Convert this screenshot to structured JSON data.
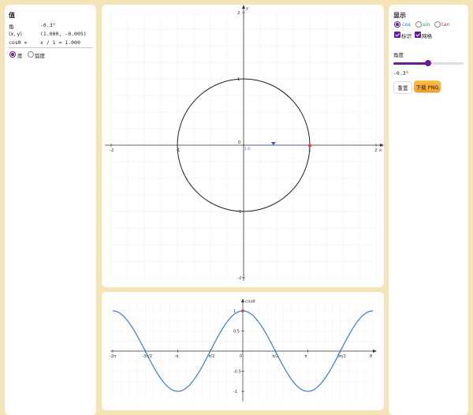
{
  "values_panel": {
    "title": "值",
    "rows": [
      {
        "label": "角",
        "value": "-0.3°"
      },
      {
        "label": "(x, y)",
        "value": "(1.000, -0.005)"
      },
      {
        "label": "cosθ =",
        "value": "x / 1 = 1.000"
      }
    ],
    "unit_options": [
      {
        "label": "度",
        "selected": true
      },
      {
        "label": "弧度",
        "selected": false
      }
    ]
  },
  "display_panel": {
    "title": "显示",
    "functions": [
      {
        "label": "cos",
        "color": "#2f6fd6",
        "selected": true
      },
      {
        "label": "sin",
        "color": "#2aa04a",
        "selected": false
      },
      {
        "label": "tan",
        "color": "#e0401e",
        "selected": false
      }
    ],
    "checkboxes": [
      {
        "label": "标识",
        "checked": true
      },
      {
        "label": "网格",
        "checked": true
      }
    ],
    "angle_label": "角度",
    "angle_value": "-0.3°",
    "angle_fraction": 0.499,
    "reset_label": "重置",
    "download_label": "下载 PNG"
  },
  "colors": {
    "accent": "#6a1b9a",
    "curve": "#3a7bdc",
    "point": "#e53935",
    "background": "#f5e4b8"
  },
  "unit_circle": {
    "angle_deg": -0.3,
    "x_ticks": [
      "-2",
      "-1",
      "0",
      "1",
      "2"
    ],
    "y_ticks": [
      "2",
      "1",
      "-1",
      "-2"
    ],
    "x_axis_label": "x",
    "y_axis_label": "y",
    "origin_label": "0",
    "x_mark": "1.0"
  },
  "chart_data": {
    "type": "line",
    "series": [
      {
        "name": "cosθ",
        "values_function": "cos"
      }
    ],
    "x_ticks": [
      "-2π",
      "-3π/2",
      "-π",
      "-π/2",
      "0",
      "π/2",
      "π",
      "3π/2",
      "θ"
    ],
    "y_ticks": [
      "1",
      "0.5",
      "-0.5",
      "-1"
    ],
    "y_axis_label": "cosθ",
    "xlim": [
      -6.2832,
      6.2832
    ],
    "ylim": [
      -1.1,
      1.1
    ],
    "marker": {
      "x": -0.005,
      "y": 1.0
    },
    "grid": true
  }
}
